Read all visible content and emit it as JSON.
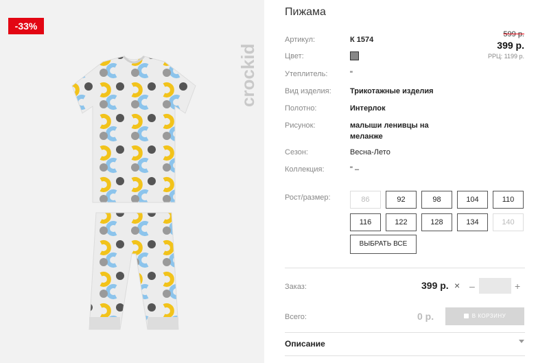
{
  "image": {
    "discount_badge": "-33%",
    "brand": "crockid"
  },
  "product": {
    "title": "Пижама",
    "price": {
      "old": "599 р.",
      "new": "399 р.",
      "rrp": "РРЦ: 1199 р."
    },
    "props": [
      {
        "label": "Артикул:",
        "value": "К 1574"
      },
      {
        "label": "Цвет:",
        "value": ""
      },
      {
        "label": "Утеплитель:",
        "value": "\""
      },
      {
        "label": "Вид изделия:",
        "value": "Трикотажные изделия"
      },
      {
        "label": "Полотно:",
        "value": "Интерлок"
      },
      {
        "label": "Рисунок:",
        "value": "малыши ленивцы на меланже"
      },
      {
        "label": "Сезон:",
        "value": "Весна-Лето"
      },
      {
        "label": "Коллекция:",
        "value": "\" –"
      }
    ],
    "color_swatch": "#888888"
  },
  "sizes": {
    "label": "Рост/размер:",
    "options": [
      {
        "value": "86",
        "available": false
      },
      {
        "value": "92",
        "available": true
      },
      {
        "value": "98",
        "available": true
      },
      {
        "value": "104",
        "available": true
      },
      {
        "value": "110",
        "available": true
      },
      {
        "value": "116",
        "available": true
      },
      {
        "value": "122",
        "available": true
      },
      {
        "value": "128",
        "available": true
      },
      {
        "value": "134",
        "available": true
      },
      {
        "value": "140",
        "available": false
      }
    ],
    "select_all": "ВЫБРАТЬ ВСЕ"
  },
  "order": {
    "label": "Заказ:",
    "price": "399 р.",
    "times": "×",
    "minus": "–",
    "plus": "+",
    "quantity": ""
  },
  "total": {
    "label": "Всего:",
    "value": "0 р.",
    "cart_button": "В КОРЗИНУ"
  },
  "description": {
    "title": "Описание"
  },
  "colors": {
    "discount": "#e30613",
    "cart_disabled": "#d6d6d6"
  }
}
